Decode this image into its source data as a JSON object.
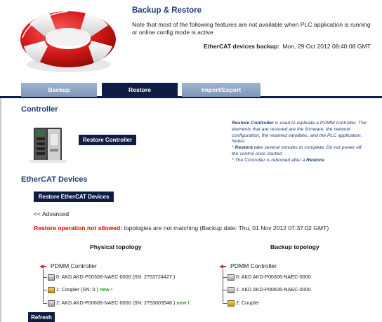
{
  "header": {
    "title": "Backup & Restore",
    "note_line1": "Note that most of the following features are not available when PLC application is running",
    "note_line2": "or online config mode is active",
    "backup_label": "EtherCAT devices backup:",
    "backup_date": "Mon, 29 Oct 2012 08:40:08 GMT"
  },
  "tabs": [
    {
      "label": "Backup",
      "active": false
    },
    {
      "label": "Restore",
      "active": true
    },
    {
      "label": "Import/Export",
      "active": false
    }
  ],
  "controller": {
    "title": "Controller",
    "button": "Restore Controller",
    "help": {
      "l1_bold": "Restore Controller",
      "l1_rest": " is used to replicate a PDMM controller. The",
      "l2": "elements that are restored are the firmware, the network",
      "l3": "configuration, the retained variables, and the PLC application.",
      "l4": "Notes:",
      "l5_pre": "* ",
      "l5_bold": "Restore",
      "l5_rest": " take several minutes to complete. Do not power off",
      "l6": "the control once started.",
      "l7_pre": "* The Controller is rebooted after a ",
      "l7_bold": "Restore",
      "l7_post": "."
    }
  },
  "ethercat": {
    "title": "EtherCAT Devices",
    "button": "Restore EtherCAT Devices",
    "advanced": "<< Advanced",
    "warning_red": "Restore operation not allowed:",
    "warning_rest": " topologies are not matching (Backup date: Thu, 01 Nov 2012 07:37:02 GMT)"
  },
  "physical": {
    "title": "Physical topology",
    "root": "PDMM Controller",
    "nodes": [
      {
        "text": "0: AKD AKD-P00306-NAEC-0000 (SN: 2753724427 )",
        "new": "",
        "icon": "drive"
      },
      {
        "text": "1: Coupler (SN: 0 ) ",
        "new": "new !",
        "icon": "coupler"
      },
      {
        "text": "2: AKD AKD-P00606-NAEC-0000 (SN: 2753003548 ) ",
        "new": "new !",
        "icon": "drive"
      }
    ]
  },
  "backup_topo": {
    "title": "Backup topology",
    "root": "PDMM Controller",
    "nodes": [
      {
        "text": "0: AKD AKD-P00306-NAEC-0000",
        "icon": "drive"
      },
      {
        "text": "1: AKD AKD-P00606-NAEC-0000",
        "icon": "drive"
      },
      {
        "text": "2: Coupler",
        "icon": "coupler"
      }
    ]
  },
  "refresh_button": "Refresh",
  "colors": {
    "accent_dark": "#0f1d45",
    "title_blue": "#1f3b78",
    "warning_red": "#e00000",
    "new_green": "#23a11f",
    "inactive_tab": "#8aa3c2"
  }
}
